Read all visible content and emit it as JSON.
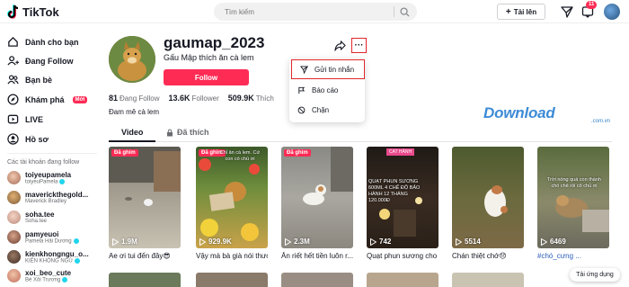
{
  "brand": {
    "name": "TikTok"
  },
  "search": {
    "placeholder": "Tìm kiếm"
  },
  "topbar": {
    "upload_label": "Tải lên",
    "inbox_count": "11"
  },
  "sidebar": {
    "items": [
      {
        "label": "Dành cho bạn",
        "icon": "home-icon"
      },
      {
        "label": "Đang Follow",
        "icon": "following-icon"
      },
      {
        "label": "Bạn bè",
        "icon": "friends-icon"
      },
      {
        "label": "Khám phá",
        "icon": "explore-icon",
        "badge": "Mới"
      },
      {
        "label": "LIVE",
        "icon": "live-icon"
      },
      {
        "label": "Hồ sơ",
        "icon": "profile-icon"
      }
    ],
    "following_title": "Các tài khoản đang follow",
    "accounts": [
      {
        "name": "toiyeupamela",
        "sub": "toiyeuPamela",
        "verified": true
      },
      {
        "name": "maverickthegold...",
        "sub": "Maverick Bradley",
        "verified": false
      },
      {
        "name": "soha.tee",
        "sub": "Soha.tee",
        "verified": false
      },
      {
        "name": "pamyeuoi",
        "sub": "Pamela Hải Dương",
        "verified": true
      },
      {
        "name": "kienkhongngu_o...",
        "sub": "KIÊN KHÔNG NGỦ",
        "verified": true
      },
      {
        "name": "xoi_beo_cute",
        "sub": "Bé Xôi Trương",
        "verified": true
      }
    ]
  },
  "profile": {
    "username": "gaumap_2023",
    "nickname": "Gấu Mập thích ăn cà lem",
    "follow_label": "Follow",
    "following_count": "81",
    "following_label": "Đang Follow",
    "followers_count": "13.6K",
    "followers_label": "Follower",
    "likes_count": "509.9K",
    "likes_label": "Thích",
    "bio": "Đam mê cà lem",
    "more_label": "···"
  },
  "menu": {
    "items": [
      {
        "label": "Gửi tin nhắn",
        "icon": "send-icon"
      },
      {
        "label": "Báo cáo",
        "icon": "flag-icon"
      },
      {
        "label": "Chặn",
        "icon": "block-icon"
      }
    ]
  },
  "tabs": {
    "video": "Video",
    "liked": "Đã thích"
  },
  "watermark": {
    "text": "Download",
    "sub": ".com.vn"
  },
  "videos": [
    {
      "pinned": "Đã ghim",
      "views": "1.9M",
      "caption": "Ae ơi tui đến đây😎",
      "text": ""
    },
    {
      "pinned": "Đã ghim",
      "views": "929.9K",
      "caption": "Vậy mà bà già nói thươ...",
      "text": "Chỉ ăn cà lem. Cứ\ncon có chú ơi"
    },
    {
      "pinned": "Đã ghim",
      "views": "2.3M",
      "caption": "Ăn riết hết tiền luôn r...",
      "text": ""
    },
    {
      "pinned": "",
      "views": "742",
      "caption": "Quạt phun sương cho ...",
      "text": "QUẠT PHUN SƯƠNG\n600ML 4 CHẾ ĐỘ BẢO\nHÀNH 12 THÁNG\n120.000Đ",
      "tag": "CAT HÀNH"
    },
    {
      "pinned": "",
      "views": "5514",
      "caption": "Chán thiệt chớ😞",
      "text": ""
    },
    {
      "pinned": "",
      "views": "6469",
      "caption": "#chó_cưng ...",
      "text": "Trời nóng quá con thành\nchó chê rồi cô chủ ơi"
    }
  ],
  "download_pill": "Tải ứng dụng"
}
